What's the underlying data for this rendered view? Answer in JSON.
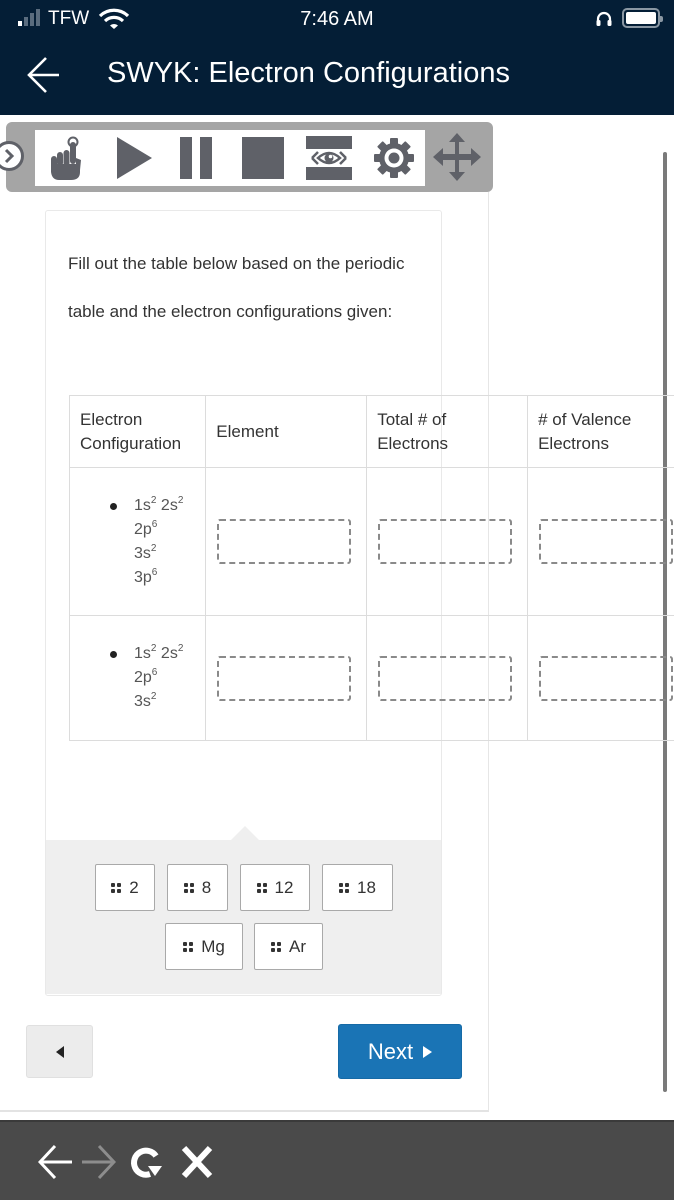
{
  "status_bar": {
    "carrier": "TFW",
    "time": "7:46 AM",
    "signal_bars_on": 1,
    "signal_bars_total": 4,
    "icons": [
      "wifi-icon",
      "headphones-icon",
      "battery-icon"
    ]
  },
  "header": {
    "title": "SWYK: Electron Configurations",
    "back_icon": "arrow-left-icon"
  },
  "toolbar": {
    "tools": [
      {
        "name": "collapse",
        "icon": "chevron-right-circle-icon"
      },
      {
        "name": "pointer",
        "icon": "hand-pointer-icon"
      },
      {
        "name": "play",
        "icon": "play-icon"
      },
      {
        "name": "pause",
        "icon": "pause-icon"
      },
      {
        "name": "stop",
        "icon": "stop-icon"
      },
      {
        "name": "screen-mask",
        "icon": "eye-mask-icon"
      },
      {
        "name": "settings",
        "icon": "gear-icon"
      },
      {
        "name": "move",
        "icon": "move-arrows-icon"
      }
    ]
  },
  "question": {
    "instructions": "Fill out the table below based on the periodic table and the electron configurations given:",
    "table": {
      "headers": [
        "Electron Configuration",
        "Element",
        "Total # of Electrons",
        "# of Valence Electrons"
      ],
      "rows": [
        {
          "configuration": [
            {
              "base": "1s",
              "sup": "2",
              "base2": " 2s",
              "sup2": "2"
            },
            {
              "base": "2p",
              "sup": "6"
            },
            {
              "base": "3s",
              "sup": "2"
            },
            {
              "base": "3p",
              "sup": "6"
            }
          ],
          "element": "",
          "total_electrons": "",
          "valence_electrons": ""
        },
        {
          "configuration": [
            {
              "base": "1s",
              "sup": "2",
              "base2": " 2s",
              "sup2": "2"
            },
            {
              "base": "2p",
              "sup": "6"
            },
            {
              "base": "3s",
              "sup": "2"
            }
          ],
          "element": "",
          "total_electrons": "",
          "valence_electrons": ""
        }
      ]
    },
    "answer_bank": [
      "2",
      "8",
      "12",
      "18",
      "Mg",
      "Ar"
    ]
  },
  "navigation": {
    "prev_icon": "triangle-left-icon",
    "next_label": "Next",
    "next_icon": "triangle-right-icon",
    "next_color": "#1a74b5"
  },
  "browser_bar": {
    "icons": [
      "back-arrow-icon",
      "forward-arrow-icon",
      "reload-icon",
      "close-icon"
    ]
  }
}
